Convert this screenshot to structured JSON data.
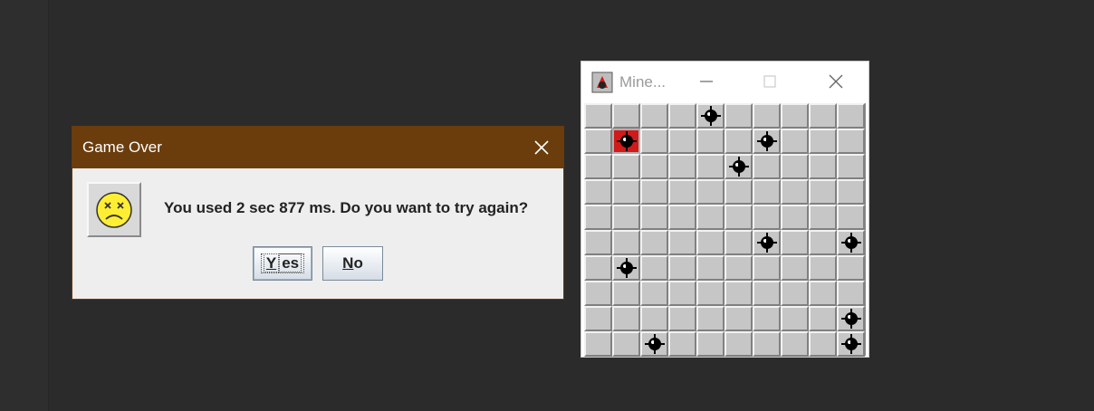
{
  "dialog": {
    "title": "Game Over",
    "message": "You used 2 sec 877 ms. Do you want to try again?",
    "yes_key": "Y",
    "yes_rest": "es",
    "no_key": "N",
    "no_rest": "o"
  },
  "minesweeper": {
    "title": "Mine...",
    "rows": 10,
    "cols": 10,
    "exploded": [
      1,
      1
    ],
    "mines": [
      [
        0,
        4
      ],
      [
        1,
        1
      ],
      [
        1,
        6
      ],
      [
        2,
        5
      ],
      [
        5,
        6
      ],
      [
        5,
        9
      ],
      [
        6,
        1
      ],
      [
        8,
        9
      ],
      [
        9,
        2
      ],
      [
        9,
        9
      ]
    ]
  }
}
